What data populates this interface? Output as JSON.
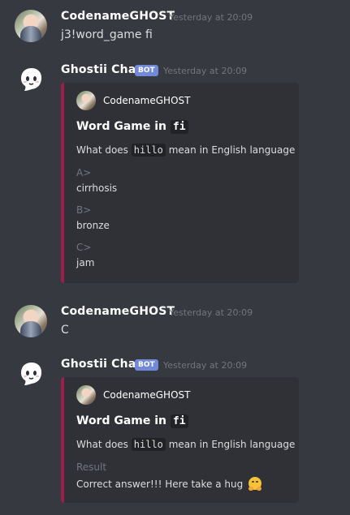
{
  "messages": [
    {
      "username": "CodenameGHOST",
      "timestamp": "Yesterday at 20:09",
      "text": "j3!word_game fi"
    },
    {
      "username": "Ghostii Chan",
      "bot_tag": "BOT",
      "timestamp": "Yesterday at 20:09",
      "embed": {
        "author": "CodenameGHOST",
        "title_prefix": "Word Game in",
        "title_code": "fi",
        "desc_prefix": "What does",
        "desc_code": "hillo",
        "desc_suffix": "mean in English language",
        "fields": [
          {
            "name": "A>",
            "value": "cirrhosis"
          },
          {
            "name": "B>",
            "value": "bronze"
          },
          {
            "name": "C>",
            "value": "jam"
          }
        ]
      }
    },
    {
      "username": "CodenameGHOST",
      "timestamp": "Yesterday at 20:09",
      "text": "C"
    },
    {
      "username": "Ghostii Chan",
      "bot_tag": "BOT",
      "timestamp": "Yesterday at 20:09",
      "embed": {
        "author": "CodenameGHOST",
        "title_prefix": "Word Game in",
        "title_code": "fi",
        "desc_prefix": "What does",
        "desc_code": "hillo",
        "desc_suffix": "mean in English language",
        "fields": [
          {
            "name": "Result",
            "value": "Correct answer!!! Here take a hug",
            "emoji": "hugging-face-emoji"
          }
        ]
      }
    }
  ],
  "colors": {
    "background": "#36393f",
    "embed_background": "#2f3136",
    "embed_accent": "#a01c4c",
    "bot_tag": "#7289da",
    "timestamp": "#72767d",
    "text": "#dcddde"
  }
}
